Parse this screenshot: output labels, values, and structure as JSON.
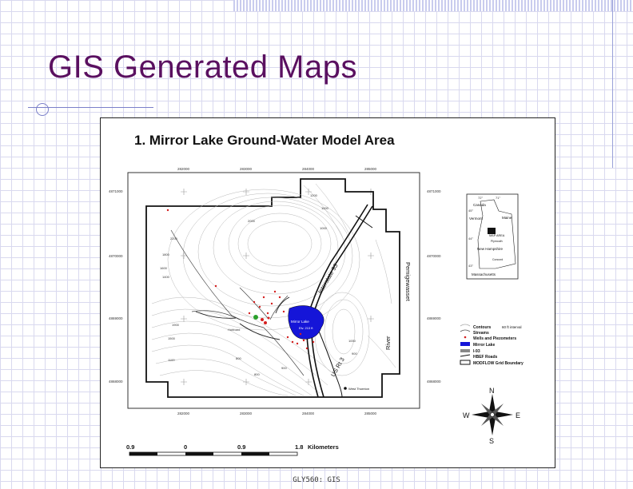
{
  "slide": {
    "title": "GIS Generated Maps",
    "footer": "GLY560: GIS"
  },
  "map": {
    "title": "1. Mirror Lake Ground-Water Model Area",
    "top_ticks": [
      "282000",
      "283000",
      "284000",
      "285000"
    ],
    "bottom_ticks": [
      "282000",
      "283000",
      "284000",
      "285000"
    ],
    "left_ticks": [
      "4871000",
      "4870000",
      "4869000",
      "4868000"
    ],
    "right_ticks": [
      "4871000",
      "4870000",
      "4869000",
      "4868000"
    ],
    "labels": {
      "interstate": "Interstate 93",
      "us": "US Rt 3",
      "river_a": "Pemigewasset",
      "river_b": "River",
      "lake": "Mirror Lake",
      "elev": "Elv. 213 ft",
      "town": "West Thornton",
      "hubbard": "Hubbard"
    },
    "contour_values": [
      "2600",
      "2400",
      "2200",
      "2000",
      "1800",
      "1600",
      "1400",
      "1200",
      "1000",
      "800",
      "900",
      "1100",
      "1300",
      "1500",
      "1700",
      "1900"
    ],
    "legend": [
      {
        "label": "Contours",
        "note": "60 ft interval"
      },
      {
        "label": "Streams",
        "note": ""
      },
      {
        "label": "Wells and Piezometers",
        "note": ""
      },
      {
        "label": "Mirror Lake",
        "note": ""
      },
      {
        "label": "I-93",
        "note": ""
      },
      {
        "label": "HBEF Roads",
        "note": ""
      },
      {
        "label": "MODFLOW Grid Boundary",
        "note": ""
      }
    ],
    "inset": {
      "labels": [
        "Canada",
        "Vermont",
        "Maine",
        "MAP AREA",
        "New Hampshire",
        "Massachusetts",
        "Plymouth",
        "Concord"
      ],
      "lat_labels": [
        "72°",
        "71°",
        "45°",
        "44°",
        "43°"
      ]
    },
    "compass": {
      "n": "N",
      "s": "S",
      "e": "E",
      "w": "W"
    },
    "scale": {
      "ticks": [
        "0.9",
        "0",
        "0.9",
        "1.8"
      ],
      "unit": "Kilometers"
    }
  }
}
